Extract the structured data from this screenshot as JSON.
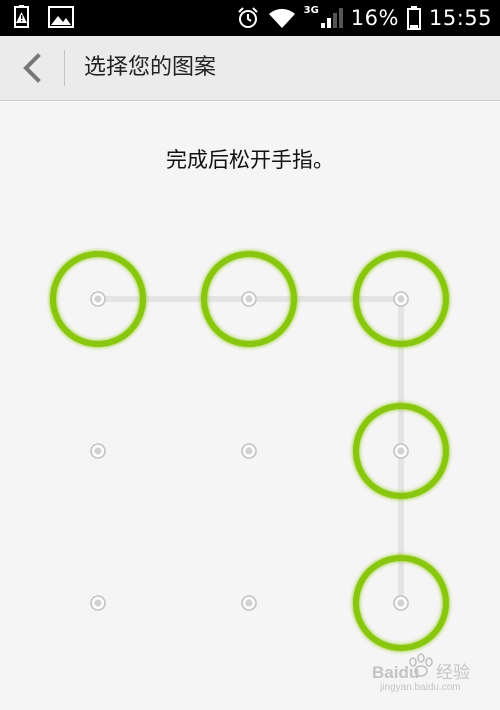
{
  "status_bar": {
    "network": "3G",
    "battery": "16%",
    "time": "15:55",
    "icons": [
      "battery-alert-icon",
      "image-icon",
      "alarm-icon",
      "wifi-icon",
      "signal-icon",
      "battery-icon"
    ]
  },
  "header": {
    "back_icon": "chevron-left-icon",
    "title": "选择您的图案"
  },
  "instruction": "完成后松开手指。",
  "pattern": {
    "accent_color": "#88c70f",
    "line_color": "#e4e4e4",
    "selected_sequence": [
      1,
      2,
      3,
      6,
      9
    ],
    "dots": [
      {
        "id": 1,
        "selected": true
      },
      {
        "id": 2,
        "selected": true
      },
      {
        "id": 3,
        "selected": true
      },
      {
        "id": 4,
        "selected": false
      },
      {
        "id": 5,
        "selected": false
      },
      {
        "id": 6,
        "selected": true
      },
      {
        "id": 7,
        "selected": false
      },
      {
        "id": 8,
        "selected": false
      },
      {
        "id": 9,
        "selected": true
      }
    ]
  },
  "watermark": {
    "brand": "Baidu",
    "suffix": "经验",
    "url": "jingyan.baidu.com"
  }
}
